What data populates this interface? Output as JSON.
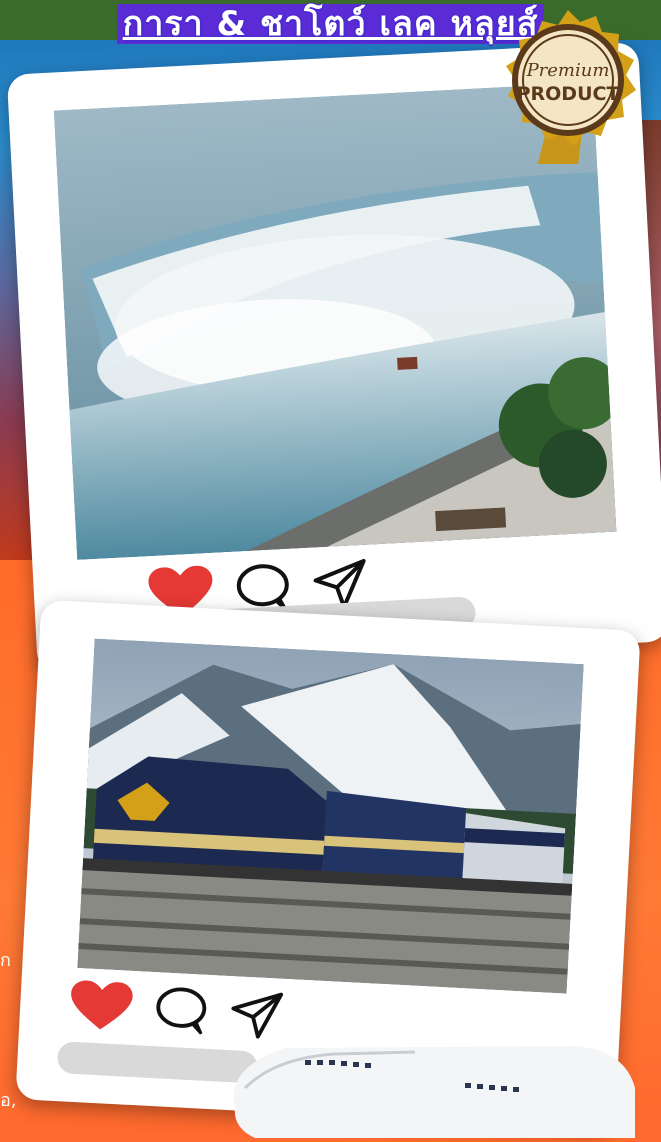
{
  "banner": {
    "title": "การา & ชาโตว์ เลค หลุยส์"
  },
  "badge": {
    "line1": "Premium",
    "line2": "PRODUCT"
  },
  "side_text": {
    "line1": "ก",
    "line2": "อ,"
  },
  "colors": {
    "orange": "#ff6a2e",
    "title_bg": "#5b2bd6",
    "heart": "#e53935",
    "gold": "#d4a017"
  },
  "posts": [
    {
      "scene": "Niagara Falls aerial view",
      "liked": true,
      "icons": [
        "heart-icon",
        "comment-icon",
        "share-icon"
      ]
    },
    {
      "scene": "Rocky Mountaineer train in the mountains",
      "liked": true,
      "icons": [
        "heart-icon",
        "comment-icon",
        "share-icon"
      ]
    }
  ]
}
